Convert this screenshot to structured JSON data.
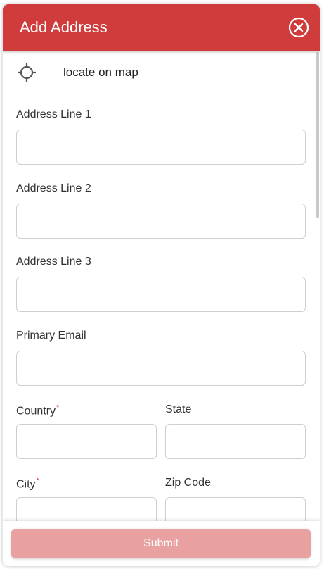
{
  "header": {
    "title": "Add Address",
    "close_icon": "close-circle-icon"
  },
  "locate": {
    "label": "locate on map",
    "icon": "crosshair-icon"
  },
  "fields": {
    "address_line_1": {
      "label": "Address Line 1",
      "value": "",
      "placeholder": ""
    },
    "address_line_2": {
      "label": "Address Line 2",
      "value": "",
      "placeholder": ""
    },
    "address_line_3": {
      "label": "Address Line 3",
      "value": "",
      "placeholder": ""
    },
    "primary_email": {
      "label": "Primary Email",
      "value": "",
      "placeholder": ""
    },
    "country": {
      "label": "Country",
      "required_mark": "*",
      "value": "",
      "placeholder": ""
    },
    "state": {
      "label": "State",
      "value": "",
      "placeholder": ""
    },
    "city": {
      "label": "City",
      "required_mark": "*",
      "value": "",
      "placeholder": ""
    },
    "zip_code": {
      "label": "Zip Code",
      "value": "",
      "placeholder": ""
    }
  },
  "footer": {
    "submit_label": "Submit"
  },
  "colors": {
    "brand_red": "#d03c3c",
    "submit_disabled": "#e9a0a0"
  }
}
